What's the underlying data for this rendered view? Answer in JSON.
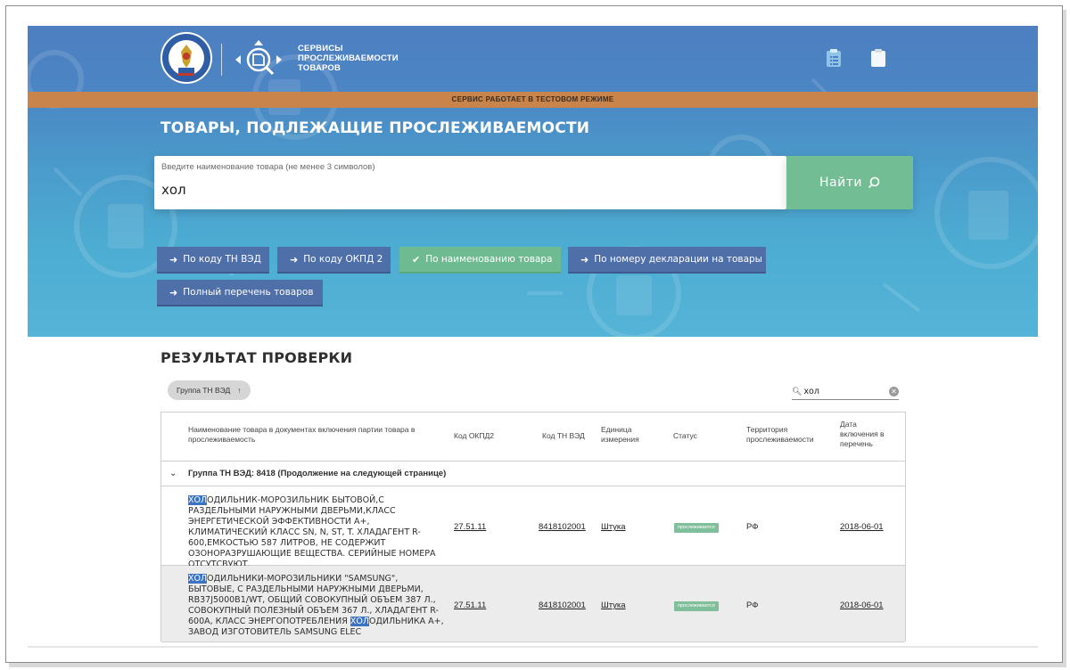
{
  "header": {
    "logo_text": "СЕРВИСЫ ПРОСЛЕЖИВАЕМОСТИ ТОВАРОВ",
    "icons": [
      "clipboard-list-icon",
      "clipboard-icon"
    ],
    "banner": "СЕРВИС РАБОТАЕТ В ТЕСТОВОМ РЕЖИМЕ"
  },
  "hero": {
    "title": "ТОВАРЫ, ПОДЛЕЖАЩИЕ ПРОСЛЕЖИВАЕМОСТИ",
    "search": {
      "label": "Введите наименование товара (не менее 3 символов)",
      "value": "хол",
      "button": "Найти"
    },
    "filters": [
      {
        "label": "По коду ТН ВЭД",
        "active": false
      },
      {
        "label": "По коду ОКПД 2",
        "active": false
      },
      {
        "label": "По наименованию товара",
        "active": true
      },
      {
        "label": "По номеру декларации на товары",
        "active": false
      },
      {
        "label": "Полный перечень товаров",
        "active": false
      }
    ]
  },
  "results": {
    "title": "РЕЗУЛЬТАТ ПРОВЕРКИ",
    "group_chip": "Группа ТН ВЭД",
    "filter_value": "хол",
    "columns": [
      "Наименование товара в документах включения партии товара в прослеживаемость",
      "Код ОКПД2",
      "Код ТН ВЭД",
      "Единица измерения",
      "Статус",
      "Территория прослеживаемости",
      "Дата включения в перечень"
    ],
    "group_label": "Группа ТН ВЭД: 8418 (Продолжение на следующей странице)",
    "rows": [
      {
        "name_highlight": "ХОЛ",
        "name_rest": "ОДИЛЬНИК-МОРОЗИЛЬНИК БЫТОВОЙ,С РАЗДЕЛЬНЫМИ НАРУЖНЫМИ ДВЕРЬМИ,КЛАСС ЭНЕРГЕТИЧЕСКОЙ ЭФФЕКТИВНОСТИ А+, КЛИМАТИЧЕСКИЙ КЛАСС SN, N, ST, T. ХЛАДАГЕНТ R-600,ЕМКОСТЬЮ 587 ЛИТРОВ, НЕ СОДЕРЖИТ ОЗОНОРАЗРУШАЮЩИЕ ВЕЩЕСТВА. СЕРИЙНЫЕ НОМЕРА ОТСУТСВУЮТ.",
        "okpd2": "27.51.11",
        "tnved": "8418102001",
        "unit": "Штука",
        "status": "прослеживается",
        "territory": "РФ",
        "date": "2018-06-01"
      },
      {
        "name_highlight": "ХОЛ",
        "name_rest_a": "ОДИЛЬНИКИ-МОРОЗИЛЬНИКИ \"SAMSUNG\", БЫТОВЫЕ, С РАЗДЕЛЬНЫМИ НАРУЖНЫМИ ДВЕРЬМИ, RB37J5000B1/WT, ОБЩИЙ СОВОКУПНЫЙ ОБЪЕМ 387 Л., СОВОКУПНЫЙ ПОЛЕЗНЫЙ ОБЪЕМ 367 Л., ХЛАДАГЕНТ R-600A, КЛАСС ЭНЕРГОПОТРЕБЛЕНИЯ ",
        "name_highlight_b": "ХОЛ",
        "name_rest_b": "ОДИЛЬНИКА А+, ЗАВОД ИЗГОТОВИТЕЛЬ SAMSUNG ELEC",
        "okpd2": "27.51.11",
        "tnved": "8418102001",
        "unit": "Штука",
        "status": "прослеживается",
        "territory": "РФ",
        "date": "2018-06-01"
      }
    ]
  },
  "colors": {
    "hero_top": "#4d7fc1",
    "hero_bottom": "#55b4d7",
    "banner": "#c8844a",
    "accent_green": "#72bd94",
    "filter_blue": "#4e6fa8",
    "highlight": "#3b74c2"
  }
}
